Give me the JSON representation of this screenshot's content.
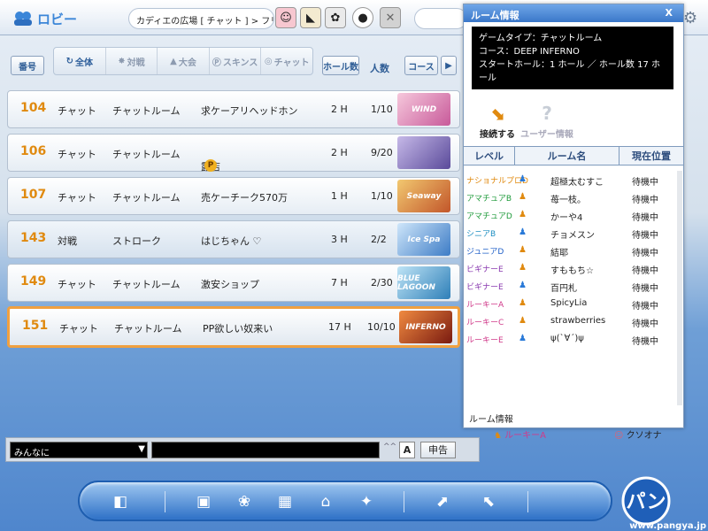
{
  "header": {
    "title": "ロビー",
    "location": "カディエの広場 [ チャット ] > フリーマ"
  },
  "filters": {
    "number_label": "番号",
    "tabs": [
      {
        "label": "全体",
        "icon": "refresh-icon"
      },
      {
        "label": "対戦",
        "icon": "versus-icon"
      },
      {
        "label": "大会",
        "icon": "tournament-icon"
      },
      {
        "label": "スキンス",
        "icon": "skins-icon"
      },
      {
        "label": "チャット",
        "icon": "chat-icon"
      }
    ],
    "holes_label": "ホール数",
    "people_label": "人数",
    "course_label": "コース"
  },
  "rooms": [
    {
      "number": "104",
      "mode": "チャット",
      "type": "チャットルーム",
      "name": "求ケーアリヘッドホン",
      "holes": "2 H",
      "count": "1/10",
      "course": "WIND"
    },
    {
      "number": "106",
      "mode": "チャット",
      "type": "チャットルーム",
      "name": "露店",
      "pp": "P",
      "holes": "2 H",
      "count": "9/20",
      "course": ""
    },
    {
      "number": "107",
      "mode": "チャット",
      "type": "チャットルーム",
      "name": "売ケーチーク570万",
      "holes": "1 H",
      "count": "1/10",
      "course": "Seaway"
    },
    {
      "number": "143",
      "mode": "対戦",
      "type": "ストローク",
      "name": "はじちゃん ♡",
      "holes": "3 H",
      "count": "2/2",
      "course": "Ice Spa"
    },
    {
      "number": "149",
      "mode": "チャット",
      "type": "チャットルーム",
      "name": "激安ショップ",
      "holes": "7 H",
      "count": "2/30",
      "course": "BLUE LAGOON"
    },
    {
      "number": "151",
      "mode": "チャット",
      "type": "チャットルーム",
      "name": "PP欲しい奴来い",
      "holes": "17 H",
      "count": "10/10",
      "course": "INFERNO"
    }
  ],
  "room_info": {
    "title": "ルーム情報",
    "close": "X",
    "lines": [
      "ゲームタイプ：チャットルーム",
      "コース：DEEP INFERNO",
      "スタートホール：1 ホール ／ ホール数 17 ホール"
    ],
    "join_label": "接続する",
    "user_info_label": "ユーザー情報",
    "columns": [
      "レベル",
      "ルーム名",
      "現在位置"
    ],
    "players": [
      {
        "level": "ナショナルプロD",
        "name": "超極太むすこ",
        "location": "待機中",
        "color": "#e08a10"
      },
      {
        "level": "アマチュアB",
        "name": "苺一枝。",
        "location": "待機中",
        "color": "#1e9a3a"
      },
      {
        "level": "アマチュアD",
        "name": "かーや4",
        "location": "待機中",
        "color": "#1e9a3a"
      },
      {
        "level": "シニアB",
        "name": "チョメスン",
        "location": "待機中",
        "color": "#1f8fc2"
      },
      {
        "level": "ジュニアD",
        "name": "結耶",
        "location": "待機中",
        "color": "#2060c8"
      },
      {
        "level": "ビギナーE",
        "name": "すももち☆",
        "location": "待機中",
        "color": "#8a3ab0"
      },
      {
        "level": "ビギナーE",
        "name": "百円札",
        "location": "待機中",
        "color": "#8a3ab0"
      },
      {
        "level": "ルーキーA",
        "name": "SpicyLia",
        "location": "待機中",
        "color": "#d03a8a"
      },
      {
        "level": "ルーキーC",
        "name": "strawberries",
        "location": "待機中",
        "color": "#d03a8a"
      },
      {
        "level": "ルーキーE",
        "name": "ψ(`∀´)ψ",
        "location": "待機中",
        "color": "#d03a8a"
      }
    ],
    "footer": "ルーム情報"
  },
  "behind": {
    "level": "ルーキーA",
    "name": "クソオナ"
  },
  "chat": {
    "target": "みんなに",
    "format_label": "A",
    "report_label": "申告"
  },
  "logo": {
    "url": "www.pangya.jp"
  },
  "colors": {
    "accent": "#3b86d8",
    "room_number": "#e08a10",
    "selected_border": "#f0a040"
  }
}
